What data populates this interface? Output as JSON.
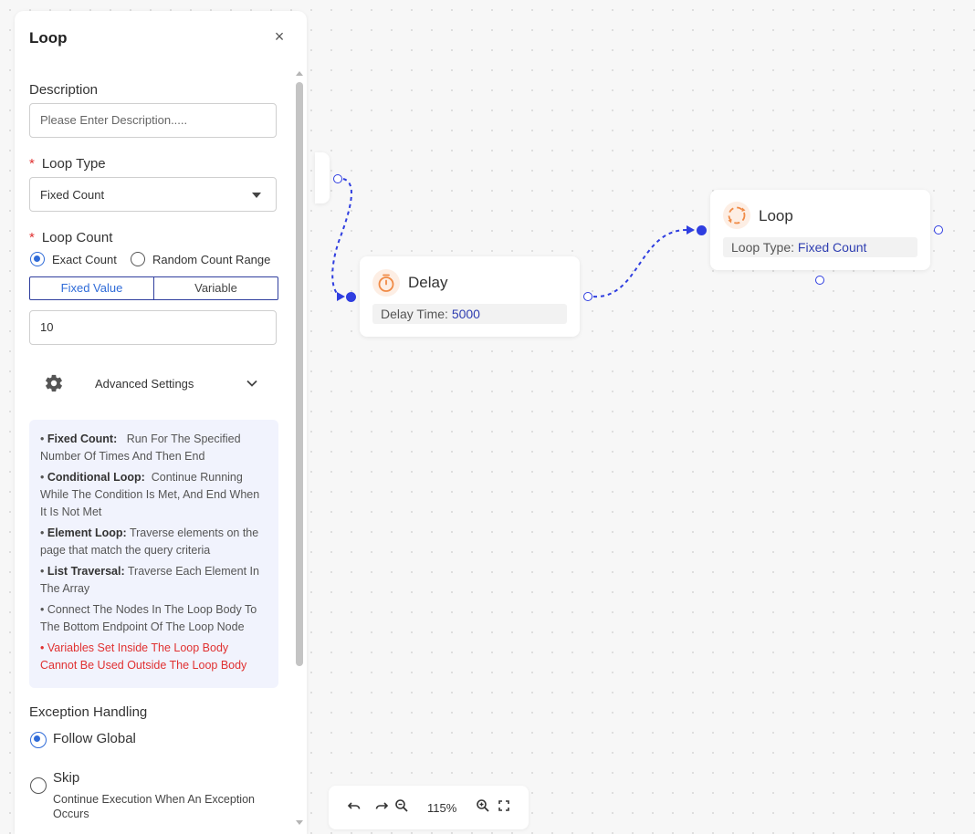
{
  "panel": {
    "title": "Loop",
    "close_icon": "×",
    "description": {
      "label": "Description",
      "placeholder": "Please Enter Description....."
    },
    "loop_type": {
      "required_mark": "*",
      "label": "Loop Type",
      "value": "Fixed Count"
    },
    "loop_count": {
      "required_mark": "*",
      "label": "Loop Count",
      "options": [
        "Exact Count",
        "Random Count Range"
      ],
      "selected_option": "Exact Count",
      "tabs": [
        "Fixed Value",
        "Variable"
      ],
      "active_tab": "Fixed Value",
      "value": "10"
    },
    "advanced_settings": {
      "label": "Advanced Settings",
      "icon": "gear-icon",
      "chevron": "chevron-down-icon"
    },
    "info": [
      {
        "title": "Fixed Count:",
        "text": "Run For The Specified Number Of Times And Then End"
      },
      {
        "title": "Conditional Loop:",
        "text": "Continue Running While The Condition Is Met, And End When It Is Not Met"
      },
      {
        "title": "Element Loop:",
        "text": "Traverse elements on the page that match the query criteria"
      },
      {
        "title": "List Traversal:",
        "text": "Traverse Each Element In The Array"
      },
      {
        "title": "",
        "text": "Connect The Nodes In The Loop Body To The Bottom Endpoint Of The Loop Node"
      },
      {
        "title": "",
        "text": "Variables Set Inside The Loop Body Cannot Be Used Outside The Loop Body",
        "warning": true
      }
    ],
    "info_bullet": "•",
    "exception_handling": {
      "label": "Exception Handling",
      "options": [
        {
          "label": "Follow Global",
          "selected": true,
          "description": ""
        },
        {
          "label": "Skip",
          "selected": false,
          "description": "Continue Execution When An Exception Occurs"
        }
      ]
    }
  },
  "canvas": {
    "delay_node": {
      "title": "Delay",
      "icon": "timer-icon",
      "prop_label": "Delay Time:",
      "prop_value": "5000"
    },
    "loop_node": {
      "title": "Loop",
      "icon": "loop-icon",
      "prop_label": "Loop Type:",
      "prop_value": "Fixed Count"
    },
    "colors": {
      "accent": "#2f3ee0",
      "icon_orange": "#f08a45",
      "warning": "#e03131"
    }
  },
  "zoombar": {
    "zoom_level": "115%",
    "undo_icon": "undo-icon",
    "redo_icon": "redo-icon",
    "zoom_out_icon": "zoom-out-icon",
    "zoom_in_icon": "zoom-in-icon",
    "fit_icon": "fullscreen-icon"
  }
}
